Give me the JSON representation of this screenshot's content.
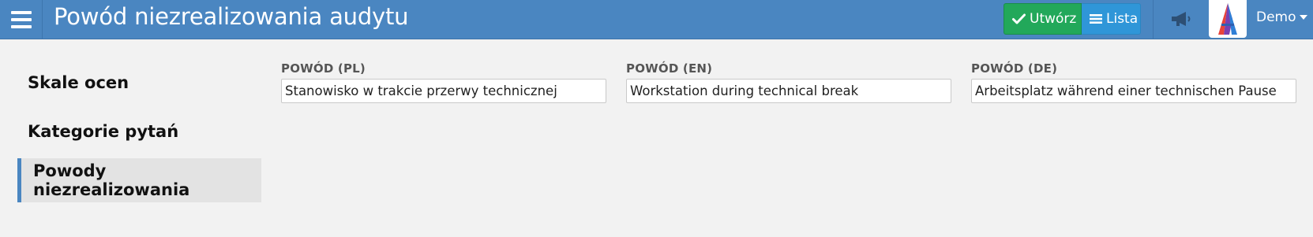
{
  "header": {
    "title": "Powód niezrealizowania audytu",
    "create_label": "Utwórz",
    "list_label": "Lista",
    "user_label": "Demo",
    "colors": {
      "bar": "#4a86c1",
      "create": "#22a85a",
      "list": "#2f96d8"
    }
  },
  "sidebar": {
    "items": [
      {
        "label": "Skale ocen",
        "active": false
      },
      {
        "label": "Kategorie pytań",
        "active": false
      },
      {
        "label": "Powody niezrealizowania",
        "active": true
      }
    ]
  },
  "form": {
    "fields": [
      {
        "label": "POWÓD (PL)",
        "value": "Stanowisko w trakcie przerwy technicznej"
      },
      {
        "label": "POWÓD (EN)",
        "value": "Workstation during technical break"
      },
      {
        "label": "POWÓD (DE)",
        "value": "Arbeitsplatz während einer technischen Pause"
      }
    ]
  },
  "icons": [
    "menu-icon",
    "check-icon",
    "list-icon",
    "megaphone-icon",
    "app-logo",
    "caret-down-icon"
  ]
}
